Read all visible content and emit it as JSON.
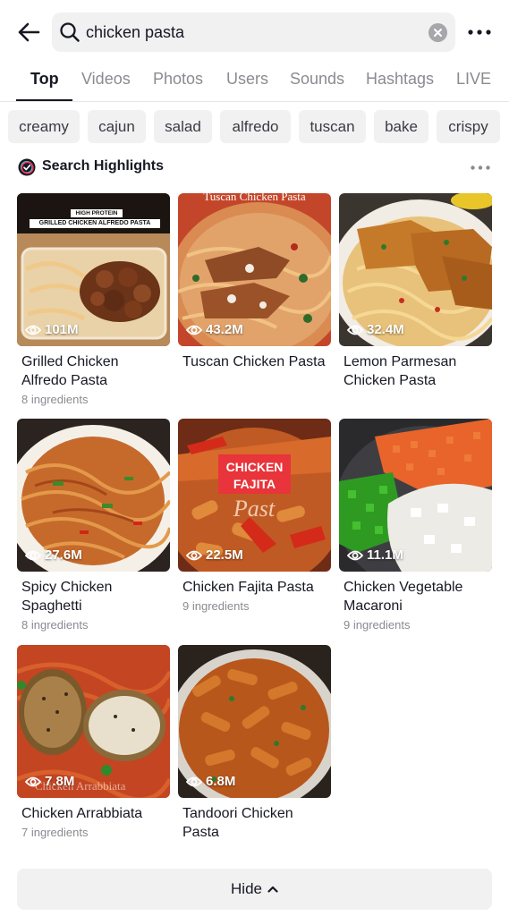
{
  "search": {
    "query": "chicken pasta"
  },
  "icons": {
    "back": "arrow-left-icon",
    "search": "search-icon",
    "clear": "clear-icon",
    "more": "more-icon",
    "views": "eye-icon",
    "hide": "chevron-up-icon"
  },
  "tabs": [
    {
      "label": "Top",
      "active": true
    },
    {
      "label": "Videos"
    },
    {
      "label": "Photos"
    },
    {
      "label": "Users"
    },
    {
      "label": "Sounds"
    },
    {
      "label": "Hashtags"
    },
    {
      "label": "LIVE"
    }
  ],
  "chips": [
    "creamy",
    "cajun",
    "salad",
    "alfredo",
    "tuscan",
    "bake",
    "crispy"
  ],
  "highlights": {
    "title": "Search Highlights",
    "cards": [
      {
        "title": "Grilled Chicken Alfredo Pasta",
        "views": "101M",
        "sub": "8 ingredients",
        "overlay_line1": "HIGH PROTEIN",
        "overlay_line2": "GRILLED CHICKEN ALFREDO PASTA"
      },
      {
        "title": "Tuscan Chicken Pasta",
        "views": "43.2M",
        "sub": "",
        "overlay": "Tuscan Chicken Pasta"
      },
      {
        "title": "Lemon Parmesan Chicken Pasta",
        "views": "32.4M",
        "sub": ""
      },
      {
        "title": "Spicy Chicken Spaghetti",
        "views": "27.6M",
        "sub": "8 ingredients"
      },
      {
        "title": "Chicken Fajita Pasta",
        "views": "22.5M",
        "sub": "9 ingredients",
        "overlay_line1": "CHICKEN",
        "overlay_line2": "FAJITA",
        "overlay_script": "Past"
      },
      {
        "title": "Chicken Vegetable Macaroni",
        "views": "11.1M",
        "sub": "9 ingredients"
      },
      {
        "title": "Chicken Arrabbiata",
        "views": "7.8M",
        "sub": "7 ingredients",
        "overlay": "Chicken Arrabbiata"
      },
      {
        "title": "Tandoori Chicken Pasta",
        "views": "6.8M",
        "sub": ""
      }
    ]
  },
  "hide_button": {
    "label": "Hide"
  },
  "colors": {
    "text": "#161823",
    "muted": "#8a8b91",
    "chip_bg": "#f1f1f2",
    "fajita_red": "#e8343a"
  }
}
